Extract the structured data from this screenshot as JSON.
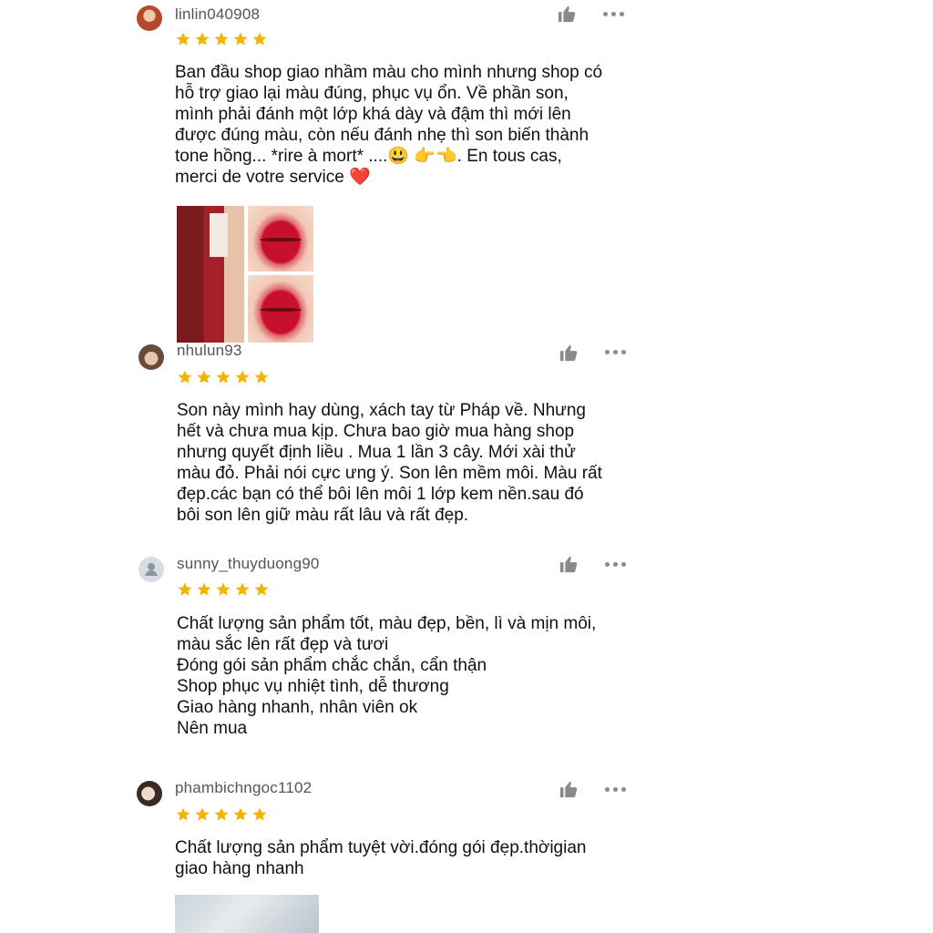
{
  "reviews": [
    {
      "username": "linlin040908",
      "rating": 5,
      "text": "Ban đầu shop giao nhầm màu cho mình nhưng shop có\nhỗ trợ giao lại màu đúng, phục vụ ổn. Về phần son,\nmình phải đánh một lớp khá dày và đậm thì mới lên\nđược đúng màu, còn nếu đánh nhẹ thì son biến thành\ntone hồng... *rire à mort* ....😃 👉👈. En tous cas,\nmerci de votre service ❤️"
    },
    {
      "username": "nhulun93",
      "rating": 5,
      "text": "Son này mình hay dùng, xách tay từ Pháp về. Nhưng\nhết và chưa mua kịp. Chưa bao giờ mua hàng shop\nnhưng quyết định liều . Mua 1 lần 3 cây. Mới xài thử\nmàu đỏ. Phải nói cực ưng ý. Son lên mềm môi. Màu rất\nđẹp.các bạn có thể bôi lên môi 1 lớp kem nền.sau đó\nbôi son lên giữ màu rất lâu và rất đẹp."
    },
    {
      "username": "sunny_thuyduong90",
      "rating": 5,
      "text": "Chất lượng sản phẩm tốt, màu đẹp, bền, lì và mịn môi,\nmàu sắc lên rất đẹp và tươi\nĐóng gói sản phẩm chắc chắn, cẩn thận\nShop phục vụ nhiệt tình, dễ thương\nGiao hàng nhanh, nhân viên ok\nNên mua"
    },
    {
      "username": "phambichngoc1102",
      "rating": 5,
      "text": "Chất lượng sản phẩm tuyệt vời.đóng gói đẹp.thờigian\ngiao hàng nhanh"
    }
  ],
  "icons": {
    "star_color": "#f5b301",
    "action_color": "#8a8a8a"
  }
}
